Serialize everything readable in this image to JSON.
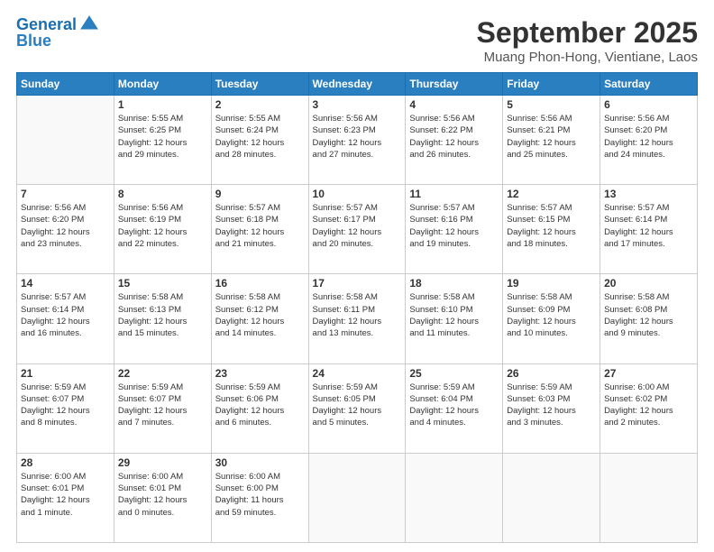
{
  "header": {
    "logo_line1": "General",
    "logo_line2": "Blue",
    "month": "September 2025",
    "location": "Muang Phon-Hong, Vientiane, Laos"
  },
  "days_of_week": [
    "Sunday",
    "Monday",
    "Tuesday",
    "Wednesday",
    "Thursday",
    "Friday",
    "Saturday"
  ],
  "weeks": [
    [
      {
        "day": "",
        "info": ""
      },
      {
        "day": "1",
        "info": "Sunrise: 5:55 AM\nSunset: 6:25 PM\nDaylight: 12 hours\nand 29 minutes."
      },
      {
        "day": "2",
        "info": "Sunrise: 5:55 AM\nSunset: 6:24 PM\nDaylight: 12 hours\nand 28 minutes."
      },
      {
        "day": "3",
        "info": "Sunrise: 5:56 AM\nSunset: 6:23 PM\nDaylight: 12 hours\nand 27 minutes."
      },
      {
        "day": "4",
        "info": "Sunrise: 5:56 AM\nSunset: 6:22 PM\nDaylight: 12 hours\nand 26 minutes."
      },
      {
        "day": "5",
        "info": "Sunrise: 5:56 AM\nSunset: 6:21 PM\nDaylight: 12 hours\nand 25 minutes."
      },
      {
        "day": "6",
        "info": "Sunrise: 5:56 AM\nSunset: 6:20 PM\nDaylight: 12 hours\nand 24 minutes."
      }
    ],
    [
      {
        "day": "7",
        "info": "Sunrise: 5:56 AM\nSunset: 6:20 PM\nDaylight: 12 hours\nand 23 minutes."
      },
      {
        "day": "8",
        "info": "Sunrise: 5:56 AM\nSunset: 6:19 PM\nDaylight: 12 hours\nand 22 minutes."
      },
      {
        "day": "9",
        "info": "Sunrise: 5:57 AM\nSunset: 6:18 PM\nDaylight: 12 hours\nand 21 minutes."
      },
      {
        "day": "10",
        "info": "Sunrise: 5:57 AM\nSunset: 6:17 PM\nDaylight: 12 hours\nand 20 minutes."
      },
      {
        "day": "11",
        "info": "Sunrise: 5:57 AM\nSunset: 6:16 PM\nDaylight: 12 hours\nand 19 minutes."
      },
      {
        "day": "12",
        "info": "Sunrise: 5:57 AM\nSunset: 6:15 PM\nDaylight: 12 hours\nand 18 minutes."
      },
      {
        "day": "13",
        "info": "Sunrise: 5:57 AM\nSunset: 6:14 PM\nDaylight: 12 hours\nand 17 minutes."
      }
    ],
    [
      {
        "day": "14",
        "info": "Sunrise: 5:57 AM\nSunset: 6:14 PM\nDaylight: 12 hours\nand 16 minutes."
      },
      {
        "day": "15",
        "info": "Sunrise: 5:58 AM\nSunset: 6:13 PM\nDaylight: 12 hours\nand 15 minutes."
      },
      {
        "day": "16",
        "info": "Sunrise: 5:58 AM\nSunset: 6:12 PM\nDaylight: 12 hours\nand 14 minutes."
      },
      {
        "day": "17",
        "info": "Sunrise: 5:58 AM\nSunset: 6:11 PM\nDaylight: 12 hours\nand 13 minutes."
      },
      {
        "day": "18",
        "info": "Sunrise: 5:58 AM\nSunset: 6:10 PM\nDaylight: 12 hours\nand 11 minutes."
      },
      {
        "day": "19",
        "info": "Sunrise: 5:58 AM\nSunset: 6:09 PM\nDaylight: 12 hours\nand 10 minutes."
      },
      {
        "day": "20",
        "info": "Sunrise: 5:58 AM\nSunset: 6:08 PM\nDaylight: 12 hours\nand 9 minutes."
      }
    ],
    [
      {
        "day": "21",
        "info": "Sunrise: 5:59 AM\nSunset: 6:07 PM\nDaylight: 12 hours\nand 8 minutes."
      },
      {
        "day": "22",
        "info": "Sunrise: 5:59 AM\nSunset: 6:07 PM\nDaylight: 12 hours\nand 7 minutes."
      },
      {
        "day": "23",
        "info": "Sunrise: 5:59 AM\nSunset: 6:06 PM\nDaylight: 12 hours\nand 6 minutes."
      },
      {
        "day": "24",
        "info": "Sunrise: 5:59 AM\nSunset: 6:05 PM\nDaylight: 12 hours\nand 5 minutes."
      },
      {
        "day": "25",
        "info": "Sunrise: 5:59 AM\nSunset: 6:04 PM\nDaylight: 12 hours\nand 4 minutes."
      },
      {
        "day": "26",
        "info": "Sunrise: 5:59 AM\nSunset: 6:03 PM\nDaylight: 12 hours\nand 3 minutes."
      },
      {
        "day": "27",
        "info": "Sunrise: 6:00 AM\nSunset: 6:02 PM\nDaylight: 12 hours\nand 2 minutes."
      }
    ],
    [
      {
        "day": "28",
        "info": "Sunrise: 6:00 AM\nSunset: 6:01 PM\nDaylight: 12 hours\nand 1 minute."
      },
      {
        "day": "29",
        "info": "Sunrise: 6:00 AM\nSunset: 6:01 PM\nDaylight: 12 hours\nand 0 minutes."
      },
      {
        "day": "30",
        "info": "Sunrise: 6:00 AM\nSunset: 6:00 PM\nDaylight: 11 hours\nand 59 minutes."
      },
      {
        "day": "",
        "info": ""
      },
      {
        "day": "",
        "info": ""
      },
      {
        "day": "",
        "info": ""
      },
      {
        "day": "",
        "info": ""
      }
    ]
  ]
}
